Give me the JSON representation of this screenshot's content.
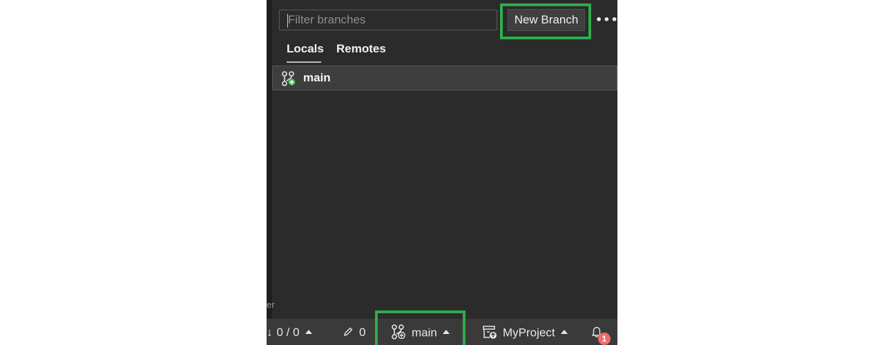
{
  "filter": {
    "placeholder": "Filter branches"
  },
  "toolbar": {
    "new_branch_label": "New Branch",
    "more_label": "•••"
  },
  "tabs": [
    {
      "label": "Locals",
      "selected": true
    },
    {
      "label": "Remotes",
      "selected": false
    }
  ],
  "branches": [
    {
      "name": "main",
      "current": true
    }
  ],
  "left_fragment": "er",
  "status_bar": {
    "sync": "0 / 0",
    "changes": "0",
    "branch": "main",
    "repository": "MyProject",
    "notifications_count": "1"
  },
  "colors": {
    "panel_bg": "#2b2b2b",
    "highlight_box": "#2fac4a",
    "status_bg": "#3a3a3a",
    "badge": "#f06a6a"
  }
}
